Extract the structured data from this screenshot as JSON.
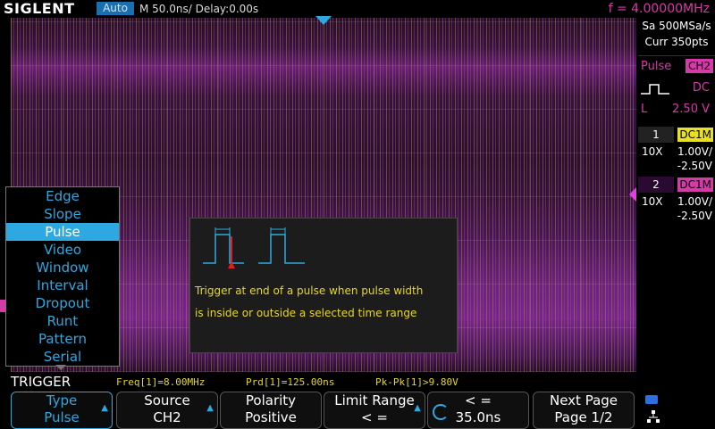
{
  "header": {
    "logo": "SIGLENT",
    "mode": "Auto",
    "timebase": "M 50.0ns/",
    "delay": "Delay:0.00s",
    "frequency": "f = 4.00000MHz"
  },
  "acq": {
    "sample_rate": "Sa 500MSa/s",
    "curr_points": "Curr 350pts"
  },
  "trigger_panel": {
    "type": "Pulse",
    "source": "CH2",
    "coupling": "DC",
    "level_label": "L",
    "level": "2.50 V"
  },
  "channels": [
    {
      "num": "1",
      "coupling": "DC1M",
      "probe": "10X",
      "scale": "1.00V/",
      "offset": "-2.50V",
      "color": "#e8e020"
    },
    {
      "num": "2",
      "coupling": "DC1M",
      "probe": "10X",
      "scale": "1.00V/",
      "offset": "-2.50V",
      "color": "#d63aa8"
    }
  ],
  "trigger_menu": {
    "items": [
      "Edge",
      "Slope",
      "Pulse",
      "Video",
      "Window",
      "Interval",
      "Dropout",
      "Runt",
      "Pattern",
      "Serial"
    ],
    "selected": "Pulse"
  },
  "help": {
    "line1": "Trigger at end of a pulse when pulse width",
    "line2": "is inside or outside a selected time range"
  },
  "bottom": {
    "menu_title": "TRIGGER",
    "freq": "Freq[1]=8.00MHz",
    "prd": "Prd[1]=125.00ns",
    "pkpk": "Pk-Pk[1]>9.80V"
  },
  "softkeys": [
    {
      "title": "Type",
      "value": "Pulse"
    },
    {
      "title": "Source",
      "value": "CH2"
    },
    {
      "title": "Polarity",
      "value": "Positive"
    },
    {
      "title": "Limit Range",
      "value": "< ="
    },
    {
      "title": "< =",
      "value": "35.0ns"
    },
    {
      "title": "Next Page",
      "value": "Page 1/2"
    }
  ],
  "colors": {
    "accent": "#2ea8e0",
    "ch1": "#e8e020",
    "ch2": "#d63aa8",
    "help_text": "#e8d820"
  }
}
